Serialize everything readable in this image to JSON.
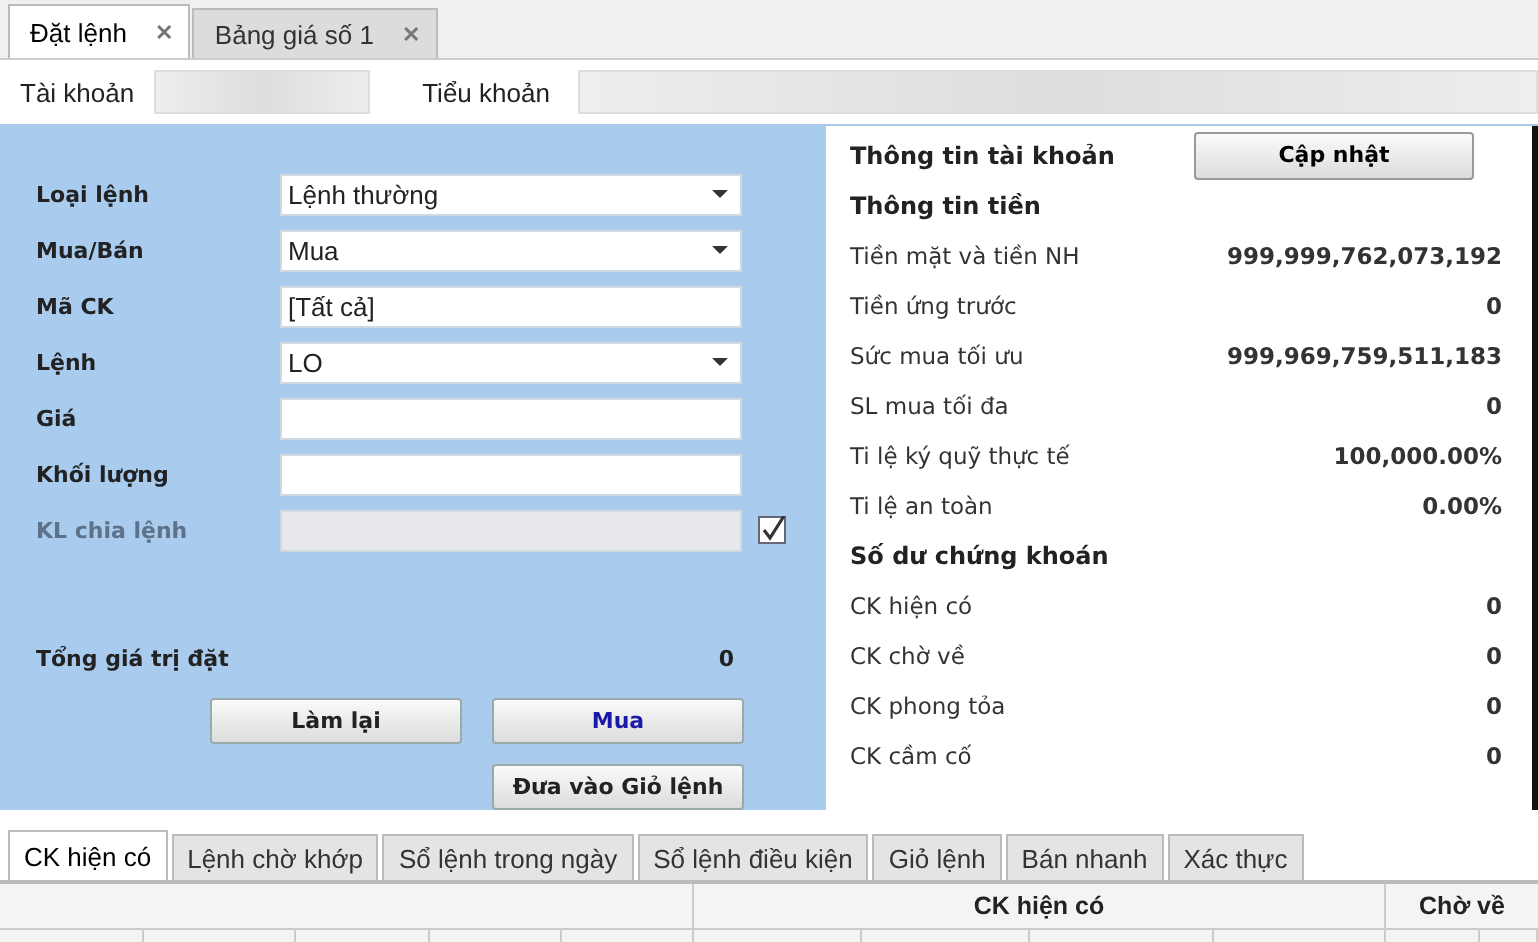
{
  "tabs": [
    {
      "label": "Đặt lệnh",
      "selected": true,
      "close": "✕"
    },
    {
      "label": "Bảng giá số 1",
      "selected": false,
      "close": "✕"
    }
  ],
  "account_bar": {
    "account_label": "Tài khoản",
    "subaccount_label": "Tiểu khoản"
  },
  "order_form": {
    "fields": [
      {
        "label": "Loại lệnh",
        "kind": "select",
        "value": "Lệnh thường",
        "disabled": false
      },
      {
        "label": "Mua/Bán",
        "kind": "select",
        "value": "Mua",
        "disabled": false
      },
      {
        "label": "Mã CK",
        "kind": "text",
        "value": "[Tất cả]",
        "disabled": false
      },
      {
        "label": "Lệnh",
        "kind": "select",
        "value": "LO",
        "disabled": false
      },
      {
        "label": "Giá",
        "kind": "text",
        "disabled": false
      },
      {
        "label": "Khối lượng",
        "kind": "text",
        "disabled": false
      },
      {
        "label": "KL chia lệnh",
        "kind": "text",
        "disabled": true,
        "checkbox": {
          "checked": true
        }
      }
    ],
    "total_label": "Tổng giá trị đặt",
    "total_value": "0",
    "buttons": [
      {
        "label": "Làm lại",
        "kind": "plain"
      },
      {
        "label": "Mua",
        "kind": "primary"
      },
      {
        "label": "Đưa vào Giỏ lệnh",
        "kind": "plain"
      }
    ]
  },
  "account_info": {
    "title": "Thông tin tài khoản",
    "refresh_button": "Cập nhật",
    "sections": [
      {
        "title": "Thông tin tiền",
        "rows": [
          {
            "label": "Tiền mặt và tiền NH",
            "value": "999,999,762,073,192"
          },
          {
            "label": "Tiền ứng trước",
            "value": "0"
          },
          {
            "label": "Sức mua tối ưu",
            "value": "999,969,759,511,183"
          },
          {
            "label": "SL mua tối đa",
            "value": "0"
          },
          {
            "label": "Ti lệ ký quỹ thực tế",
            "value": "100,000.00%"
          },
          {
            "label": "Ti lệ an toàn",
            "value": "0.00%"
          }
        ]
      },
      {
        "title": "Số dư chứng khoán",
        "rows": [
          {
            "label": "CK hiện có",
            "value": "0"
          },
          {
            "label": "CK chờ về",
            "value": "0"
          },
          {
            "label": "CK phong tỏa",
            "value": "0"
          },
          {
            "label": "CK cầm cố",
            "value": "0"
          }
        ]
      }
    ]
  },
  "bottom_tabs": [
    {
      "label": "CK hiện có",
      "selected": true
    },
    {
      "label": "Lệnh chờ khớp",
      "selected": false
    },
    {
      "label": "Sổ lệnh trong ngày",
      "selected": false
    },
    {
      "label": "Sổ lệnh điều kiện",
      "selected": false
    },
    {
      "label": "Giỏ lệnh",
      "selected": false
    },
    {
      "label": "Bán nhanh",
      "selected": false
    },
    {
      "label": "Xác thực",
      "selected": false
    }
  ],
  "table": {
    "column_groups": [
      "CK hiện có",
      "Chờ về"
    ]
  }
}
